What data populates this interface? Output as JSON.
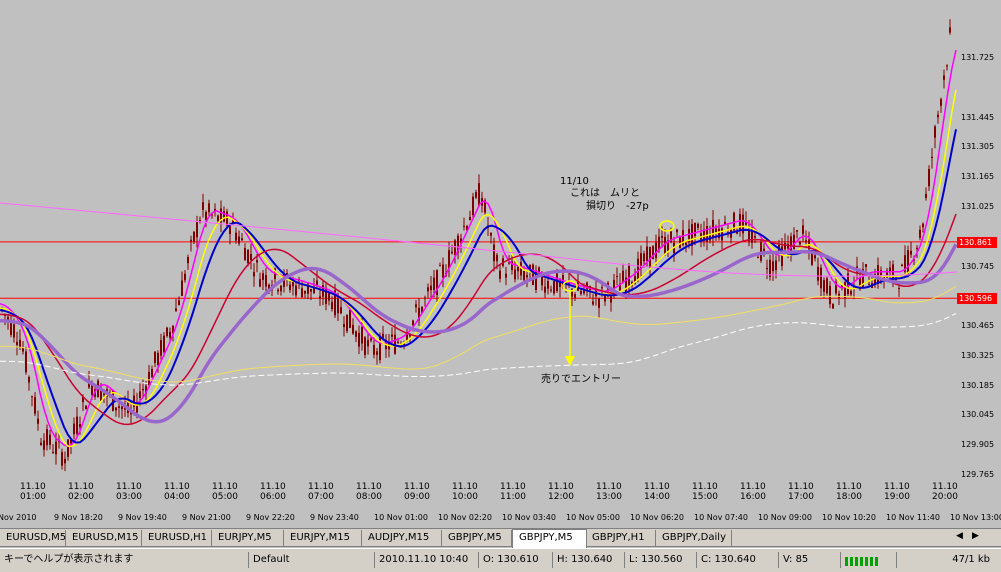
{
  "price_axis": {
    "ticks": [
      "131.725",
      "131.445",
      "131.305",
      "131.165",
      "131.025",
      "130.745",
      "130.465",
      "130.325",
      "130.185",
      "130.045",
      "129.905",
      "129.765"
    ],
    "current_marker": {
      "label": "130.861",
      "color": "#ff0000"
    },
    "entry_marker": {
      "label": "130.596",
      "color": "#ff0000"
    }
  },
  "time_axis": {
    "top_labels": [
      "11.10",
      "11.10",
      "11.10",
      "11.10",
      "11.10",
      "11.10",
      "11.10",
      "11.10",
      "11.10",
      "11.10",
      "11.10",
      "11.10",
      "11.10",
      "11.10",
      "11.10",
      "11.10",
      "11.10",
      "11.10",
      "11.10",
      "11.10"
    ],
    "bottom_labels": [
      "01:00",
      "02:00",
      "03:00",
      "04:00",
      "05:00",
      "06:00",
      "07:00",
      "08:00",
      "09:00",
      "10:00",
      "11:00",
      "12:00",
      "13:00",
      "14:00",
      "15:00",
      "16:00",
      "17:00",
      "18:00",
      "19:00",
      "20:00"
    ],
    "date_labels": [
      "Nov 2010",
      "9 Nov 18:20",
      "9 Nov 19:40",
      "9 Nov 21:00",
      "9 Nov 22:20",
      "9 Nov 23:40",
      "10 Nov 01:00",
      "10 Nov 02:20",
      "10 Nov 03:40",
      "10 Nov 05:00",
      "10 Nov 06:20",
      "10 Nov 07:40",
      "10 Nov 09:00",
      "10 Nov 10:20",
      "10 Nov 11:40",
      "10 Nov 13:00"
    ]
  },
  "annotations": {
    "note_date": "11/10",
    "note_line1": "これは　ムリと",
    "note_line2": "損切り　-27p",
    "entry_label": "売りでエントリー"
  },
  "tabs": {
    "items": [
      "EURUSD,M5",
      "EURUSD,M15",
      "EURUSD,H1",
      "EURJPY,M5",
      "EURJPY,M15",
      "AUDJPY,M15",
      "GBPJPY,M5",
      "GBPJPY,M5",
      "GBPJPY,H1",
      "GBPJPY,Daily"
    ],
    "active_index": 7,
    "nav_prev_icon": "arrow-left-icon",
    "nav_next_icon": "arrow-right-icon"
  },
  "status_bar": {
    "help_text": "キーでヘルプが表示されます",
    "profile": "Default",
    "datetime": "2010.11.10 10:40",
    "open": "O: 130.610",
    "high": "H: 130.640",
    "low": "L: 130.560",
    "close": "C: 130.640",
    "volume": "V: 85",
    "traffic": "47/1 kb",
    "connection_icon": "connection-bars-icon"
  },
  "colors": {
    "chart_bg": "#c0c0c0",
    "candle": "#800000",
    "ma_fast_magenta": "#ff00ff",
    "ma_yellow": "#ffff00",
    "ma_blue": "#0000cc",
    "ma_red": "#cc0033",
    "ma_purple": "#9966cc",
    "hline_red": "#ff0000",
    "arrow_yellow": "#ffff00"
  }
}
